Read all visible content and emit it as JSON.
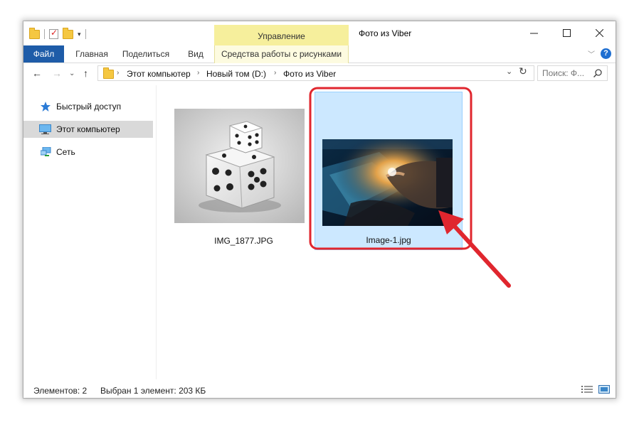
{
  "title_bar": {
    "window_title": "Фото из Viber",
    "context_group_label": "Управление",
    "minimize_icon": "minimize-icon",
    "maximize_icon": "maximize-icon",
    "close_icon": "close-icon"
  },
  "ribbon": {
    "tabs": [
      {
        "label": "Файл"
      },
      {
        "label": "Главная"
      },
      {
        "label": "Поделиться"
      },
      {
        "label": "Вид"
      },
      {
        "label": "Средства работы с рисунками"
      }
    ],
    "file_tab_color": "#1e5ca8",
    "context_tab_color": "#f6ef9c"
  },
  "address_bar": {
    "crumbs": [
      "Этот компьютер",
      "Новый том (D:)",
      "Фото из Viber"
    ]
  },
  "search": {
    "placeholder": "Поиск: Ф..."
  },
  "nav_pane": {
    "items": [
      {
        "label": "Быстрый доступ",
        "icon": "star-icon"
      },
      {
        "label": "Этот компьютер",
        "icon": "computer-icon",
        "selected": true
      },
      {
        "label": "Сеть",
        "icon": "network-icon"
      }
    ]
  },
  "files": [
    {
      "name": "IMG_1877.JPG",
      "selected": false,
      "thumbnail": "dice-photo"
    },
    {
      "name": "Image-1.jpg",
      "selected": true,
      "thumbnail": "touchscreen-hand-photo"
    }
  ],
  "status_bar": {
    "items_count": "Элементов: 2",
    "selection": "Выбран 1 элемент: 203 КБ"
  },
  "colors": {
    "selection_fill": "#cce8ff",
    "selection_border": "#99d1ff",
    "annotation_red": "#e0262e"
  }
}
